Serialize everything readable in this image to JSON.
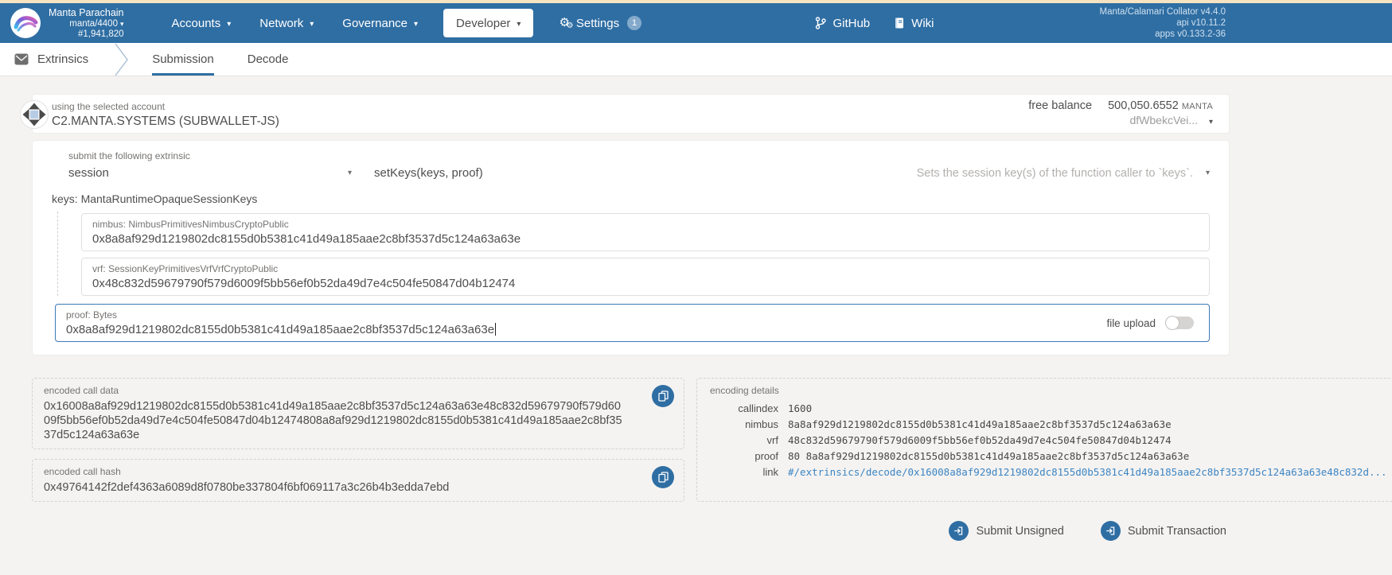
{
  "colors": {
    "header": "#2f6ea3",
    "top_strip": "#f6e3c1",
    "accent_blue": "#2f6ea3",
    "link_blue": "#3c85c4",
    "page_bg": "#f5f3f1"
  },
  "header": {
    "chain": {
      "name": "Manta Parachain",
      "spec": "manta/4400",
      "block": "#1,941,820"
    },
    "nav": [
      {
        "label": "Accounts"
      },
      {
        "label": "Network"
      },
      {
        "label": "Governance"
      },
      {
        "label": "Developer"
      },
      {
        "label": "Settings",
        "badge": "1"
      }
    ],
    "links": [
      {
        "label": "GitHub"
      },
      {
        "label": "Wiki"
      }
    ],
    "version": {
      "line1": "Manta/Calamari Collator v4.4.0",
      "line2": "api v10.11.2",
      "line3": "apps v0.133.2-36"
    }
  },
  "tabbar": {
    "section": "Extrinsics",
    "tabs": [
      {
        "label": "Submission"
      },
      {
        "label": "Decode"
      }
    ]
  },
  "account": {
    "label": "using the selected account",
    "name": "C2.MANTA.SYSTEMS (SUBWALLET-JS)",
    "balance_label": "free balance",
    "balance_value": "500,050.6552",
    "balance_unit": "MANTA",
    "address_short": "dfWbekcVei..."
  },
  "extrinsic": {
    "section_label": "submit the following extrinsic",
    "pallet": "session",
    "method": "setKeys(keys, proof)",
    "hint": "Sets the session key(s) of the function caller to `keys`.",
    "keys_label": "keys: MantaRuntimeOpaqueSessionKeys",
    "params": [
      {
        "label": "nimbus: NimbusPrimitivesNimbusCryptoPublic",
        "value": "0x8a8af929d1219802dc8155d0b5381c41d49a185aae2c8bf3537d5c124a63a63e"
      },
      {
        "label": "vrf: SessionKeyPrimitivesVrfVrfCryptoPublic",
        "value": "0x48c832d59679790f579d6009f5bb56ef0b52da49d7e4c504fe50847d04b12474"
      }
    ],
    "proof": {
      "label": "proof: Bytes",
      "value": "0x8a8af929d1219802dc8155d0b5381c41d49a185aae2c8bf3537d5c124a63a63e",
      "file_upload_label": "file upload"
    }
  },
  "encoded": {
    "call_data_label": "encoded call data",
    "call_data": "0x16008a8af929d1219802dc8155d0b5381c41d49a185aae2c8bf3537d5c124a63a63e48c832d59679790f579d6009f5bb56ef0b52da49d7e4c504fe50847d04b12474808a8af929d1219802dc8155d0b5381c41d49a185aae2c8bf3537d5c124a63a63e",
    "call_hash_label": "encoded call hash",
    "call_hash": "0x49764142f2def4363a6089d8f0780be337804f6bf069117a3c26b4b3edda7ebd"
  },
  "encoding_details": {
    "title": "encoding details",
    "rows": [
      {
        "label": "callindex",
        "value": "1600"
      },
      {
        "label": "nimbus",
        "value": "8a8af929d1219802dc8155d0b5381c41d49a185aae2c8bf3537d5c124a63a63e"
      },
      {
        "label": "vrf",
        "value": "48c832d59679790f579d6009f5bb56ef0b52da49d7e4c504fe50847d04b12474"
      },
      {
        "label": "proof",
        "value": "80 8a8af929d1219802dc8155d0b5381c41d49a185aae2c8bf3537d5c124a63a63e"
      },
      {
        "label": "link",
        "value": "#/extrinsics/decode/0x16008a8af929d1219802dc8155d0b5381c41d49a185aae2c8bf3537d5c124a63a63e48c832d..."
      }
    ]
  },
  "actions": {
    "submit_unsigned": "Submit Unsigned",
    "submit_transaction": "Submit Transaction"
  }
}
